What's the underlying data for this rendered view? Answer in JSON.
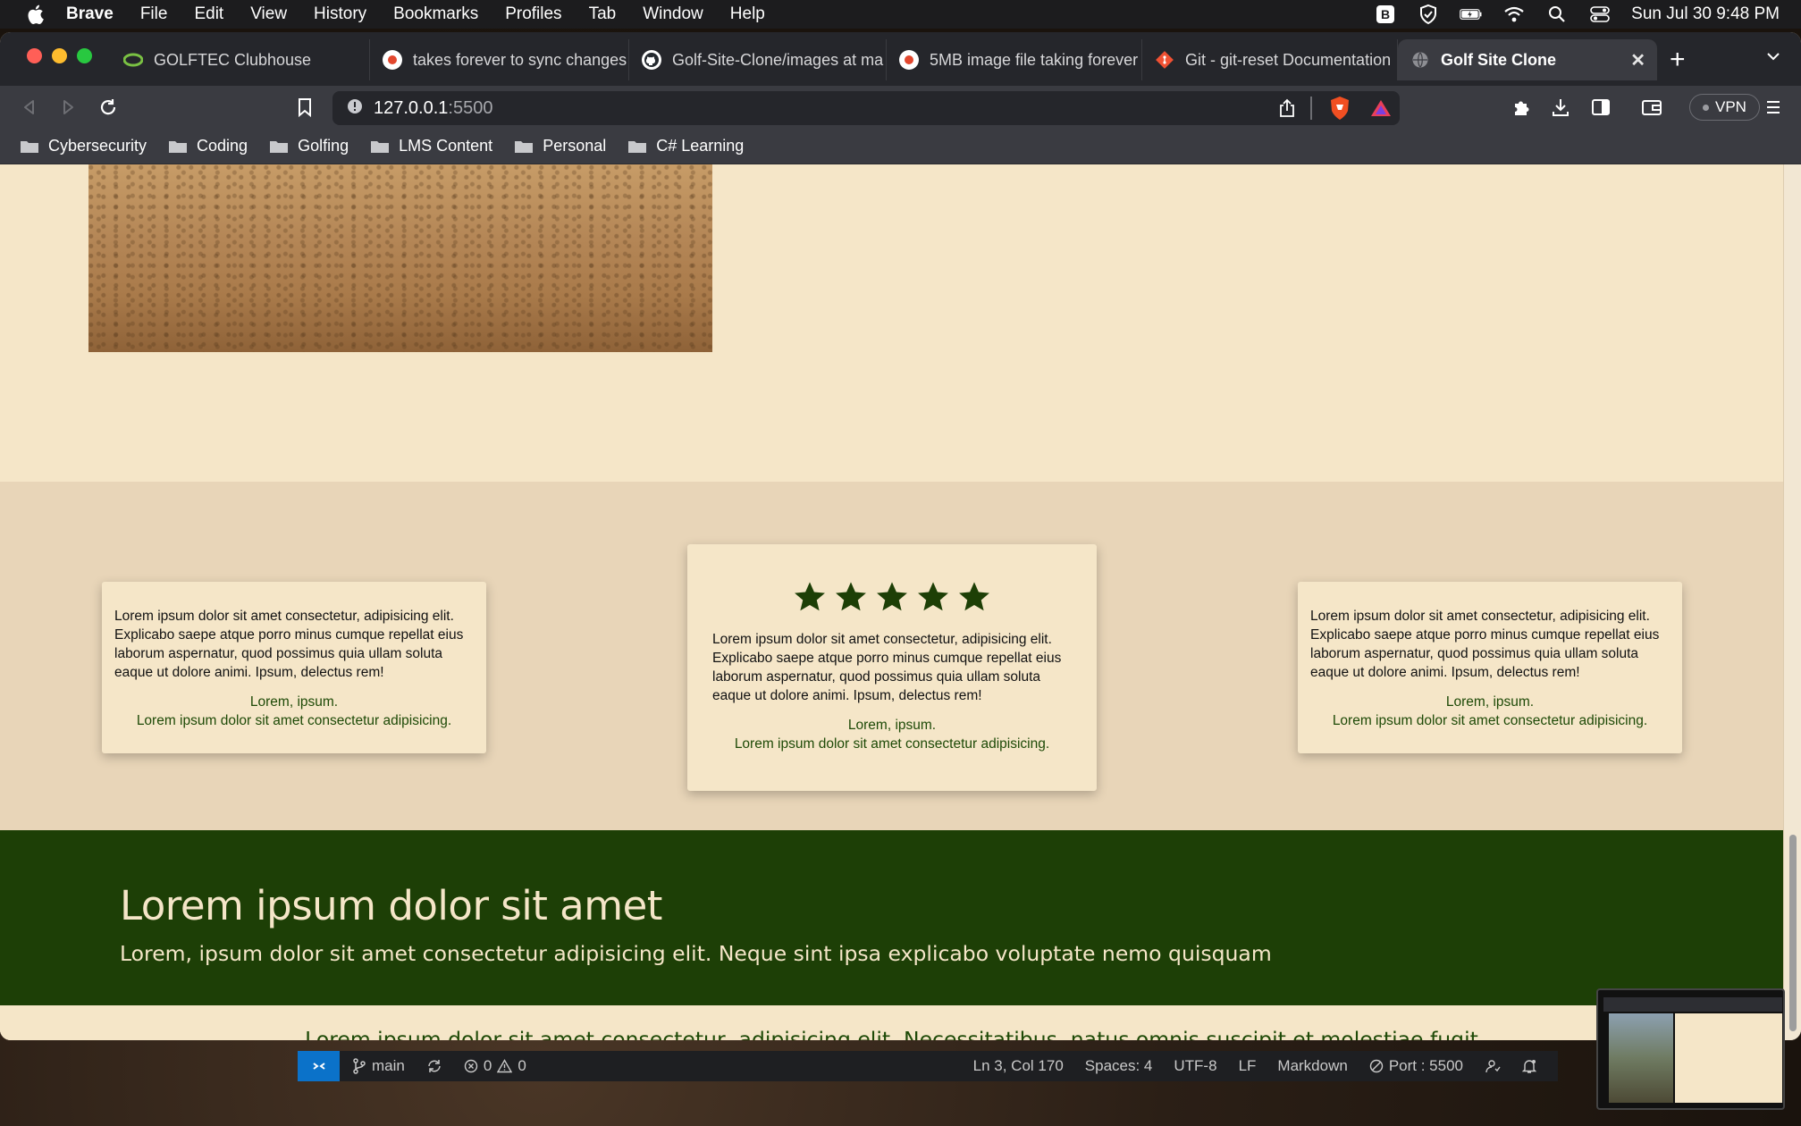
{
  "menubar": {
    "app": "Brave",
    "items": [
      "File",
      "Edit",
      "View",
      "History",
      "Bookmarks",
      "Profiles",
      "Tab",
      "Window",
      "Help"
    ],
    "datetime": "Sun Jul 30  9:48 PM"
  },
  "tabs": [
    {
      "title": "GOLFTEC Clubhouse",
      "icon": "golftec-icon"
    },
    {
      "title": "takes forever to sync changes",
      "icon": "brave-search-icon"
    },
    {
      "title": "Golf-Site-Clone/images at ma",
      "icon": "github-icon"
    },
    {
      "title": "5MB image file taking forever",
      "icon": "brave-search-icon"
    },
    {
      "title": "Git - git-reset Documentation",
      "icon": "git-icon"
    },
    {
      "title": "Golf Site Clone",
      "icon": "globe-icon"
    }
  ],
  "address": {
    "host": "127.0.0.1",
    "port": ":5500"
  },
  "toolbar": {
    "vpn": "VPN"
  },
  "bookmarks": [
    "Cybersecurity",
    "Coding",
    "Golfing",
    "LMS Content",
    "Personal",
    "C# Learning"
  ],
  "testimonials": [
    {
      "text": "Lorem ipsum dolor sit amet consectetur, adipisicing elit. Explicabo saepe atque porro minus cumque repellat eius laborum aspernatur, quod possimus quia ullam soluta eaque ut dolore animi. Ipsum, delectus rem!",
      "author": "Lorem, ipsum.",
      "attribution": "Lorem ipsum dolor sit amet consectetur adipisicing."
    },
    {
      "text": "Lorem ipsum dolor sit amet consectetur, adipisicing elit. Explicabo saepe atque porro minus cumque repellat eius laborum aspernatur, quod possimus quia ullam soluta eaque ut dolore animi. Ipsum, delectus rem!",
      "author": "Lorem, ipsum.",
      "attribution": "Lorem ipsum dolor sit amet consectetur adipisicing.",
      "stars": 5
    },
    {
      "text": "Lorem ipsum dolor sit amet consectetur, adipisicing elit. Explicabo saepe atque porro minus cumque repellat eius laborum aspernatur, quod possimus quia ullam soluta eaque ut dolore animi. Ipsum, delectus rem!",
      "author": "Lorem, ipsum.",
      "attribution": "Lorem ipsum dolor sit amet consectetur adipisicing."
    }
  ],
  "hero": {
    "title": "Lorem ipsum dolor sit amet",
    "subtitle": "Lorem, ipsum dolor sit amet consectetur adipisicing elit. Neque sint ipsa explicabo voluptate nemo quisquam"
  },
  "footer": {
    "text": "Lorem ipsum dolor sit amet consectetur, adipisicing elit. Necessitatibus, natus omnis suscipit et molestiae fugit"
  },
  "statusbar": {
    "branch": "main",
    "errors": "0",
    "warnings": "0",
    "position": "Ln 3, Col 170",
    "spaces": "Spaces: 4",
    "encoding": "UTF-8",
    "eol": "LF",
    "language": "Markdown",
    "port": "Port : 5500"
  },
  "colors": {
    "page_bg": "#f5e6c8",
    "section_bg": "#e8d5b8",
    "hero_bg": "#1d3f06",
    "accent_text": "#1e4a07"
  }
}
